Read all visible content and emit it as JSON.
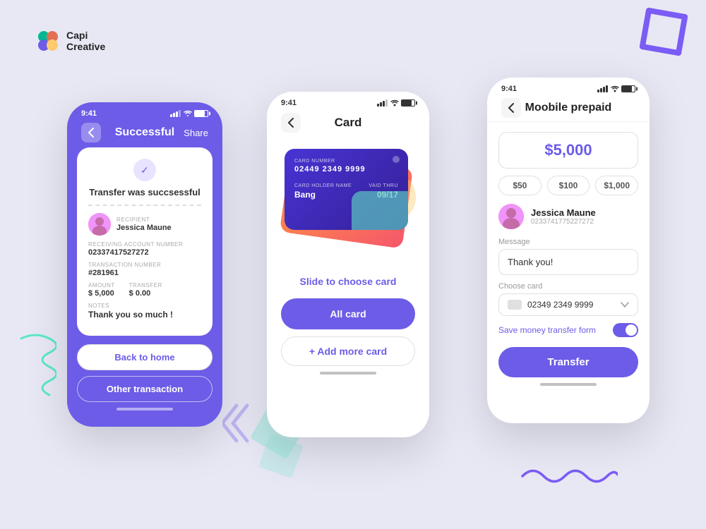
{
  "brand": {
    "name_line1": "Capi",
    "name_line2": "Creative"
  },
  "phone_left": {
    "status_bar": {
      "time": "9:41"
    },
    "header": {
      "title": "Successful",
      "share": "Share"
    },
    "receipt": {
      "transfer_text": "Transfer was succsessful",
      "recipient_label": "RECIPIENT",
      "recipient_name": "Jessica Maune",
      "account_label": "RECEIVING ACCOUNT NUMBER",
      "account_number": "02337417527272",
      "transaction_label": "TRANSACTION NUMBER",
      "transaction_number": "#281961",
      "amount_label": "AMOUNT",
      "amount_value": "$ 5,000",
      "transfer_label": "TRANSFER",
      "transfer_value": "$ 0.00",
      "notes_label": "NOTES",
      "notes_value": "Thank you so much !"
    },
    "buttons": {
      "back_home": "Back to home",
      "other_transaction": "Other transaction"
    }
  },
  "phone_mid": {
    "status_bar": {
      "time": "9:41"
    },
    "header": {
      "title": "Card"
    },
    "card_front": {
      "number_label": "CARD NUMBER",
      "number": "02449 2349 9999",
      "holder_label": "CARD HOLDER NAME",
      "holder": "Bang",
      "expiry_label": "VAID THRU",
      "expiry": "09/17"
    },
    "slide_text": "Slide to choose",
    "slide_highlight": "card",
    "buttons": {
      "all_card": "All card",
      "add_card": "+ Add more card"
    }
  },
  "phone_right": {
    "status_bar": {
      "time": "9:41"
    },
    "header": {
      "title": "Moobile prepaid"
    },
    "amount": "$5,000",
    "presets": [
      "$50",
      "$100",
      "$1,000"
    ],
    "user": {
      "name": "Jessica Maune",
      "account": "0233741775227272"
    },
    "message_label": "Message",
    "message_value": "Thank you!",
    "card_label": "Choose card",
    "card_number": "02349 2349 9999",
    "save_label": "Save money transfer form",
    "transfer_btn": "Transfer"
  }
}
